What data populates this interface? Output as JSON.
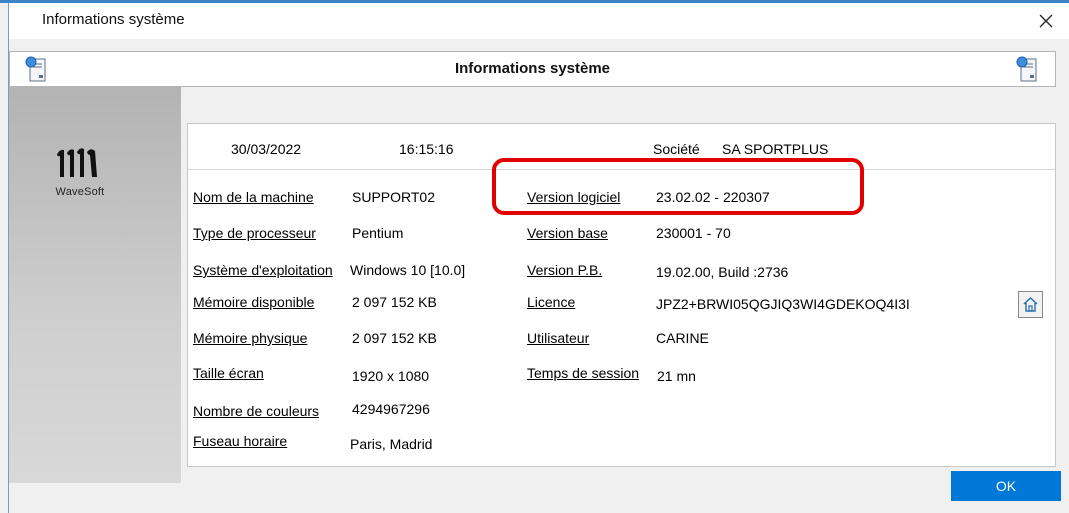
{
  "window": {
    "title": "Informations système",
    "close_icon": "close-icon"
  },
  "header": {
    "title": "Informations système",
    "icon": "system-info-icon"
  },
  "brand": {
    "name": "WaveSoft"
  },
  "info": {
    "date": "30/03/2022",
    "time": "16:15:16",
    "company_label": "Société",
    "company_value": "SA SPORTPLUS",
    "left_fields": [
      {
        "label": "Nom de la machine",
        "value": "SUPPORT02"
      },
      {
        "label": "Type de processeur",
        "value": "Pentium"
      },
      {
        "label": "Système d'exploitation",
        "value": "Windows 10 [10.0]"
      },
      {
        "label": "Mémoire disponible",
        "value": "2 097 152 KB"
      },
      {
        "label": "Mémoire physique",
        "value": "2 097 152 KB"
      },
      {
        "label": "Taille écran",
        "value": "1920 x 1080"
      },
      {
        "label": "Nombre de couleurs",
        "value": "4294967296"
      },
      {
        "label": "Fuseau horaire",
        "value": "Paris, Madrid"
      }
    ],
    "right_fields": [
      {
        "label": "Version logiciel",
        "value": "23.02.02 - 220307"
      },
      {
        "label": "Version base",
        "value": "230001 - 70"
      },
      {
        "label": "Version P.B.",
        "value": "19.02.00, Build :2736"
      },
      {
        "label": "Licence",
        "value": "JPZ2+BRWI05QGJIQ3WI4GDEKOQ4I3I"
      },
      {
        "label": "Utilisateur",
        "value": "CARINE"
      },
      {
        "label": "Temps de session",
        "value": "21 mn"
      }
    ]
  },
  "buttons": {
    "ok_label": "OK",
    "home_icon": "home-icon"
  },
  "colors": {
    "accent": "#0078d7",
    "highlight": "#e00000",
    "frame": "#3c83c8"
  }
}
